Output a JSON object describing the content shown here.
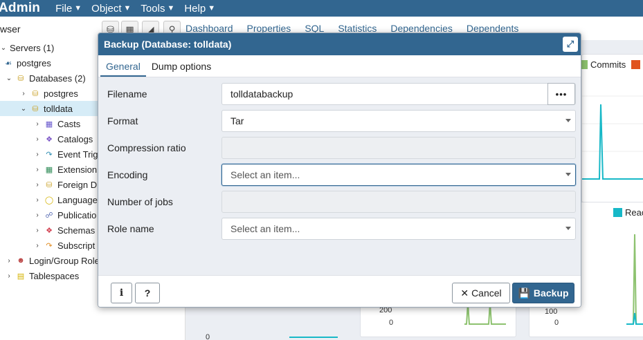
{
  "app": {
    "brand": "Admin",
    "menus": [
      "File",
      "Object",
      "Tools",
      "Help"
    ],
    "browser_label": "wser"
  },
  "main_tabs": [
    "Dashboard",
    "Properties",
    "SQL",
    "Statistics",
    "Dependencies",
    "Dependents"
  ],
  "tree": {
    "servers": "Servers (1)",
    "server": "postgres",
    "databases": "Databases (2)",
    "db1": "postgres",
    "db2": "tolldata",
    "children": [
      "Casts",
      "Catalogs",
      "Event Trig",
      "Extension",
      "Foreign D",
      "Language",
      "Publicatio",
      "Schemas",
      "Subscript"
    ],
    "login_roles": "Login/Group Role",
    "tablespaces": "Tablespaces"
  },
  "dashboard": {
    "legend_commits": "Commits",
    "legend_reads": "Reac",
    "axis_200": "200",
    "axis_0a": "0",
    "axis_100": "100",
    "axis_0b": "0",
    "axis_0c": "0",
    "colors": {
      "commits": "#8dc26f",
      "rollbacks": "#e0531f",
      "reads": "#17b8c7"
    }
  },
  "dialog": {
    "title": "Backup (Database: tolldata)",
    "tabs": [
      "General",
      "Dump options"
    ],
    "fields": {
      "filename_label": "Filename",
      "filename_value": "tolldatabackup",
      "format_label": "Format",
      "format_value": "Tar",
      "compression_label": "Compression ratio",
      "encoding_label": "Encoding",
      "encoding_placeholder": "Select an item...",
      "jobs_label": "Number of jobs",
      "role_label": "Role name",
      "role_placeholder": "Select an item..."
    },
    "buttons": {
      "file_browse": "•••",
      "info": "i",
      "help": "?",
      "cancel": "Cancel",
      "backup": "Backup"
    }
  }
}
